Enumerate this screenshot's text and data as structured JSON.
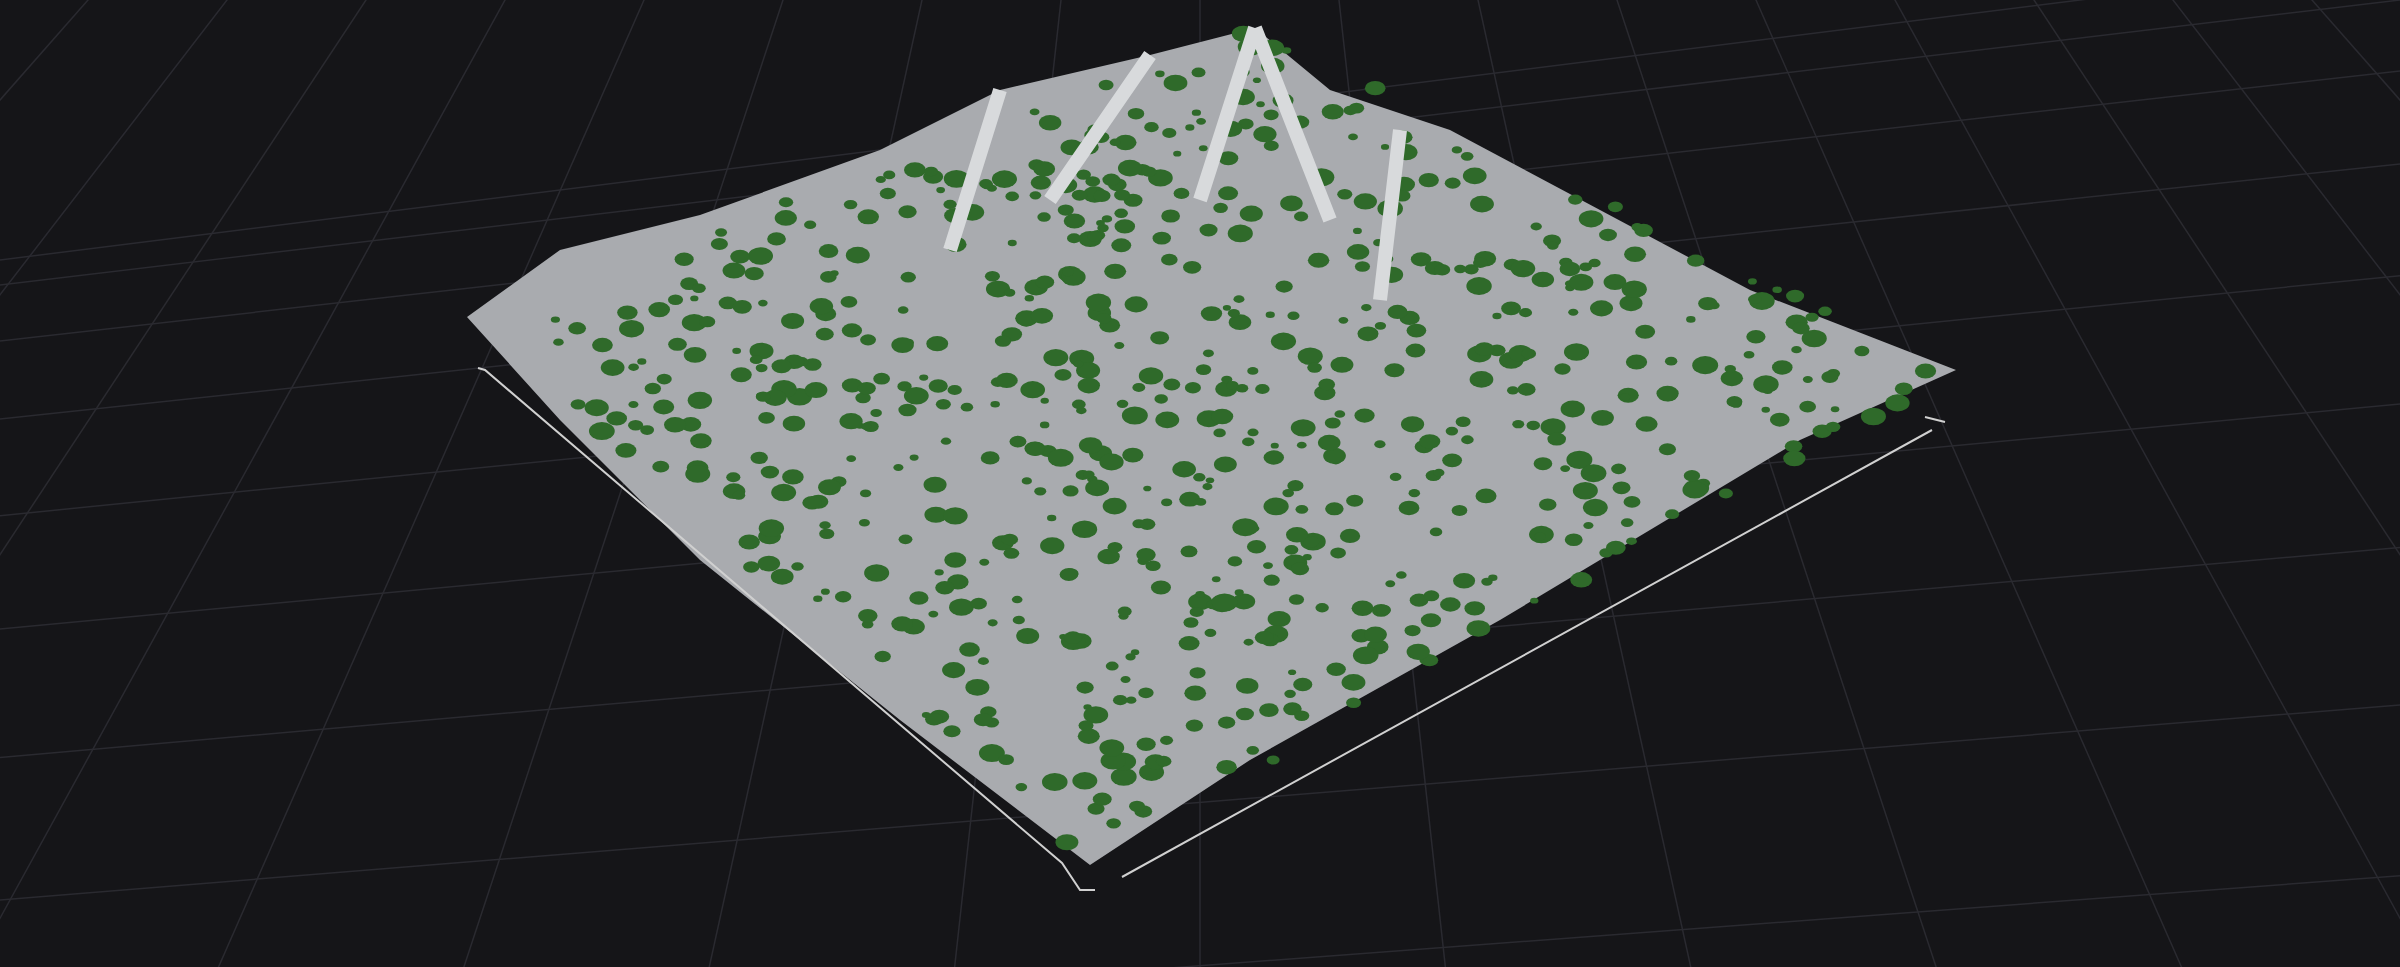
{
  "scene": {
    "kind": "terrain"
  }
}
